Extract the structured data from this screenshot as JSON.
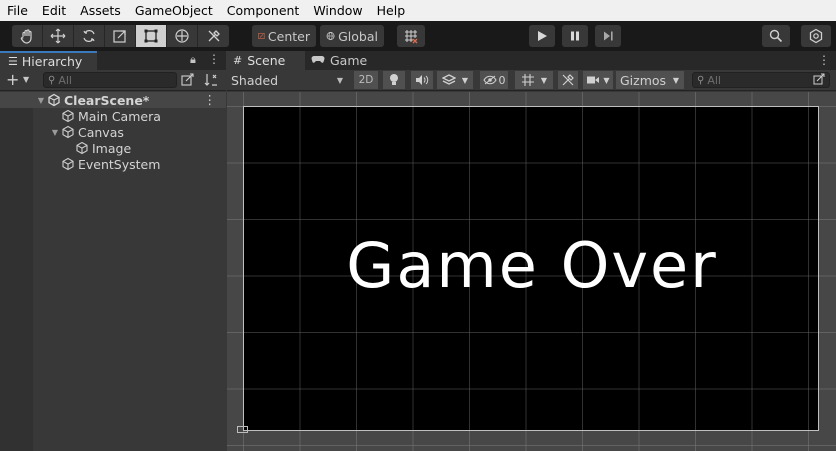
{
  "menu": [
    "File",
    "Edit",
    "Assets",
    "GameObject",
    "Component",
    "Window",
    "Help"
  ],
  "toolbar": {
    "tools": [
      "hand-tool",
      "move-tool",
      "rotate-tool",
      "scale-tool",
      "rect-tool",
      "transform-tool",
      "custom-tool"
    ],
    "active_tool": "rect-tool",
    "pivot_label": "Center",
    "space_label": "Global"
  },
  "hierarchy": {
    "tab_label": "Hierarchy",
    "search_placeholder": "All",
    "scene_name": "ClearScene*",
    "items": [
      {
        "label": "Main Camera",
        "depth": 1,
        "expandable": false
      },
      {
        "label": "Canvas",
        "depth": 1,
        "expandable": true
      },
      {
        "label": "Image",
        "depth": 2,
        "expandable": false
      },
      {
        "label": "EventSystem",
        "depth": 1,
        "expandable": false
      }
    ]
  },
  "scene_view": {
    "tabs": [
      "Scene",
      "Game"
    ],
    "active_tab": "Scene",
    "shading_mode": "Shaded",
    "mode_2d_label": "2D",
    "hidden_count": "0",
    "gizmos_label": "Gizmos",
    "search_placeholder": "All",
    "canvas_text": "Game Over"
  },
  "colors": {
    "accent": "#3a79bb",
    "canvas_background": "#000000",
    "canvas_text": "#ffffff"
  }
}
